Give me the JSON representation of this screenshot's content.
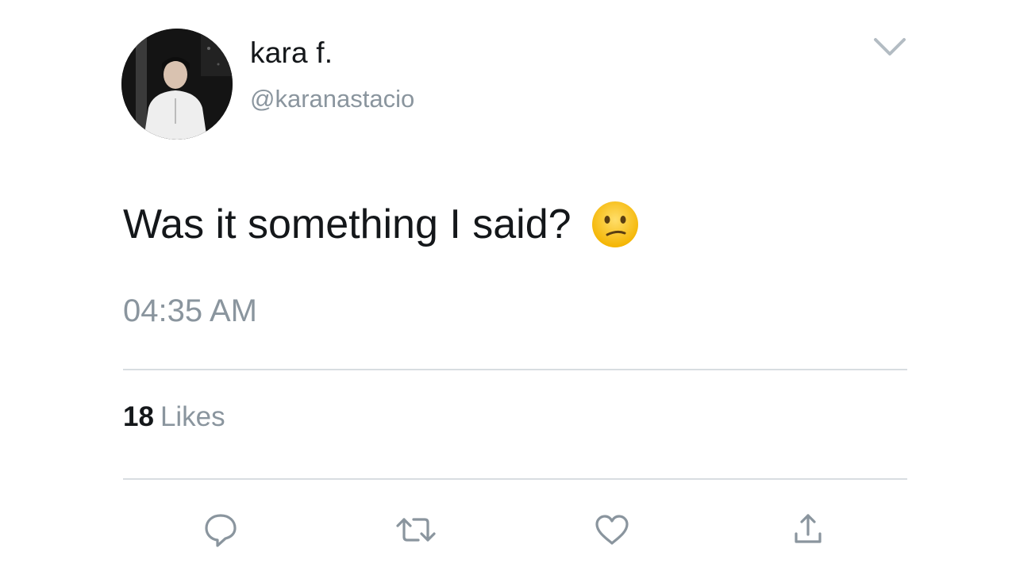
{
  "user": {
    "display_name": "kara f.",
    "handle": "@karanastacio",
    "avatar_icon": "profile-photo"
  },
  "tweet": {
    "text": "Was it something I said?",
    "emoji": "confused-face-emoji",
    "timestamp": "04:35 AM"
  },
  "stats": {
    "likes_count": "18",
    "likes_label": "Likes"
  },
  "actions": [
    {
      "name": "reply",
      "icon": "speech-bubble-icon"
    },
    {
      "name": "retweet",
      "icon": "retweet-arrows-icon"
    },
    {
      "name": "like",
      "icon": "heart-icon"
    },
    {
      "name": "share",
      "icon": "share-upload-icon"
    }
  ],
  "colors": {
    "primary_text": "#14171a",
    "secondary_text": "#8a959e",
    "icon": "#8a959e",
    "divider": "#d8dde1"
  }
}
